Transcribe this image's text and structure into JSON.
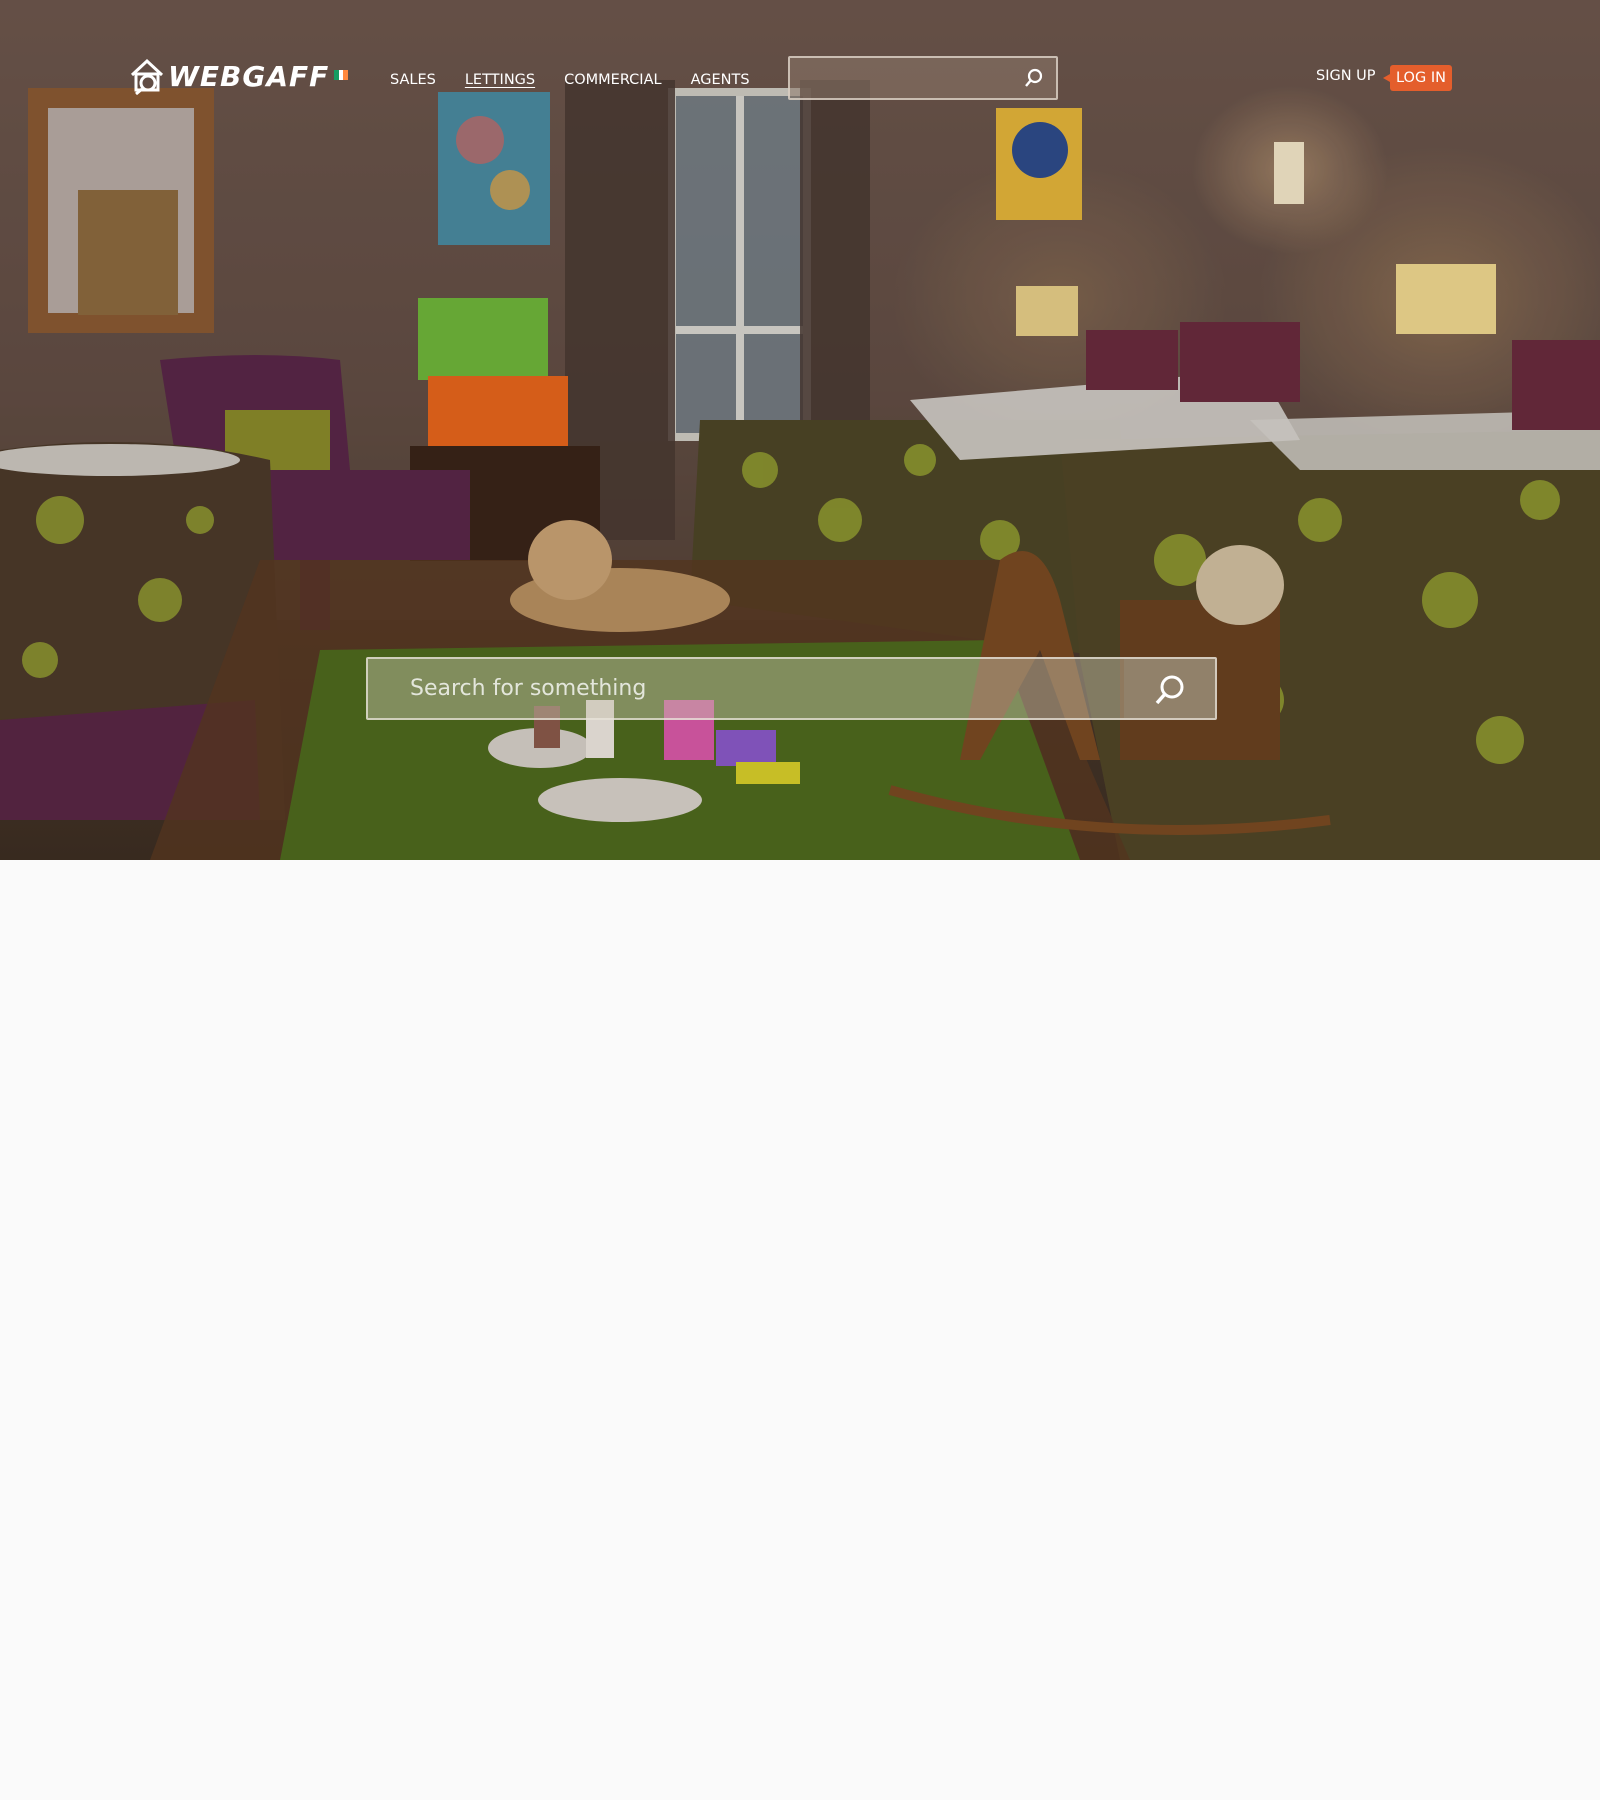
{
  "brand": {
    "name": "WEBGAFF",
    "logo_icon": "house-magnifier-icon",
    "flag_icon": "ireland-flag-icon",
    "flag_colors": [
      "#169b62",
      "#ffffff",
      "#ff883e"
    ]
  },
  "nav": {
    "items": [
      {
        "label": "SALES",
        "active": false
      },
      {
        "label": "LETTINGS",
        "active": true
      },
      {
        "label": "COMMERCIAL",
        "active": false
      },
      {
        "label": "AGENTS",
        "active": false
      }
    ]
  },
  "header_search": {
    "value": "",
    "placeholder": "",
    "icon": "search-icon"
  },
  "auth": {
    "signup_label": "SIGN UP",
    "login_label": "LOG IN",
    "login_color": "#e45e2c"
  },
  "hero_search": {
    "value": "",
    "placeholder": "Search for something",
    "icon": "search-icon"
  }
}
